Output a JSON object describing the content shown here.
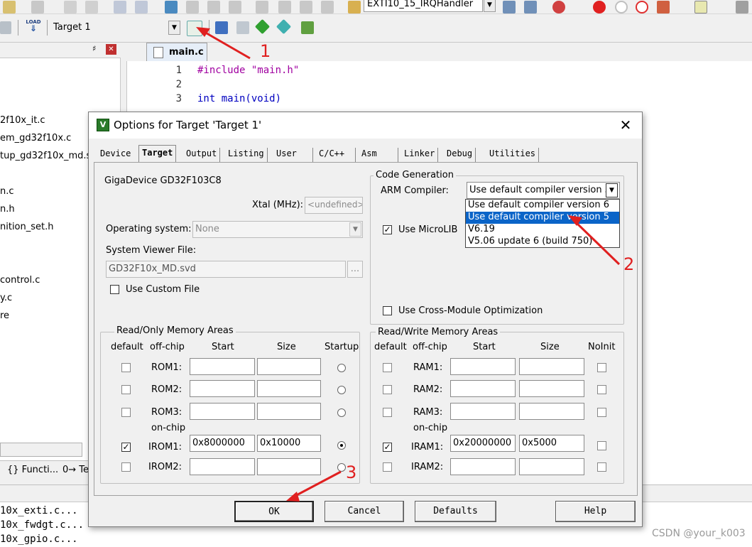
{
  "toolbar": {
    "function_combo": "EXTI10_15_IRQHandler",
    "load_label": "LOAD",
    "target_combo": "Target 1"
  },
  "annotations": {
    "one": "1",
    "two": "2",
    "three": "3"
  },
  "left_panel": {
    "items": [
      "2f10x_it.c",
      "em_gd32f10x.c",
      "tup_gd32f10x_md.s",
      "n.c",
      "n.h",
      "nition_set.h",
      "control.c",
      "y.c",
      "re"
    ],
    "bottom_tabs": [
      "{} Functi...",
      "0→ Te"
    ]
  },
  "editor": {
    "tab": "main.c",
    "lines": [
      {
        "n": "1",
        "code": "#include \"main.h\""
      },
      {
        "n": "2",
        "code": ""
      },
      {
        "n": "3",
        "code": "int main(void)"
      }
    ]
  },
  "build_output": [
    "10x_exti.c...",
    "10x_fwdgt.c...",
    "10x_gpio.c..."
  ],
  "dialog": {
    "title": "Options for Target 'Target 1'",
    "close": "✕",
    "tabs": [
      "Device",
      "Target",
      "Output",
      "Listing",
      "User",
      "C/C++",
      "Asm",
      "Linker",
      "Debug",
      "Utilities"
    ],
    "device": "GigaDevice GD32F103C8",
    "xtal_label": "Xtal (MHz):",
    "xtal_value": "<undefined>",
    "os_label": "Operating system:",
    "os_value": "None",
    "svd_label": "System Viewer File:",
    "svd_value": "GD32F10x_MD.svd",
    "browse": "...",
    "custom_file_label": "Use Custom File",
    "codegen": {
      "title": "Code Generation",
      "compiler_label": "ARM Compiler:",
      "compiler_value": "Use default compiler version 5",
      "options": [
        "Use default compiler version 6",
        "Use default compiler version 5",
        "V6.19",
        "V5.06 update 6 (build 750)"
      ],
      "microlib_label": "Use MicroLIB",
      "microlib_checked": true,
      "crossmod_label": "Use Cross-Module Optimization"
    },
    "rom": {
      "title": "Read/Only Memory Areas",
      "headers": {
        "def": "default",
        "off": "off-chip",
        "start": "Start",
        "size": "Size",
        "startup": "Startup"
      },
      "onchip": "on-chip",
      "rows": [
        {
          "name": "ROM1:",
          "start": "",
          "size": ""
        },
        {
          "name": "ROM2:",
          "start": "",
          "size": ""
        },
        {
          "name": "ROM3:",
          "start": "",
          "size": ""
        },
        {
          "name": "IROM1:",
          "start": "0x8000000",
          "size": "0x10000"
        },
        {
          "name": "IROM2:",
          "start": "",
          "size": ""
        }
      ]
    },
    "ram": {
      "title": "Read/Write Memory Areas",
      "headers": {
        "def": "default",
        "off": "off-chip",
        "start": "Start",
        "size": "Size",
        "noinit": "NoInit"
      },
      "onchip": "on-chip",
      "rows": [
        {
          "name": "RAM1:",
          "start": "",
          "size": ""
        },
        {
          "name": "RAM2:",
          "start": "",
          "size": ""
        },
        {
          "name": "RAM3:",
          "start": "",
          "size": ""
        },
        {
          "name": "IRAM1:",
          "start": "0x20000000",
          "size": "0x5000"
        },
        {
          "name": "IRAM2:",
          "start": "",
          "size": ""
        }
      ]
    },
    "buttons": {
      "ok": "OK",
      "cancel": "Cancel",
      "defaults": "Defaults",
      "help": "Help"
    }
  },
  "watermark": "CSDN @your_k003",
  "colors": {
    "selection": "#0a64c8",
    "annotation": "#e02020",
    "keyword": "#0000c0",
    "string": "#a000a0"
  }
}
